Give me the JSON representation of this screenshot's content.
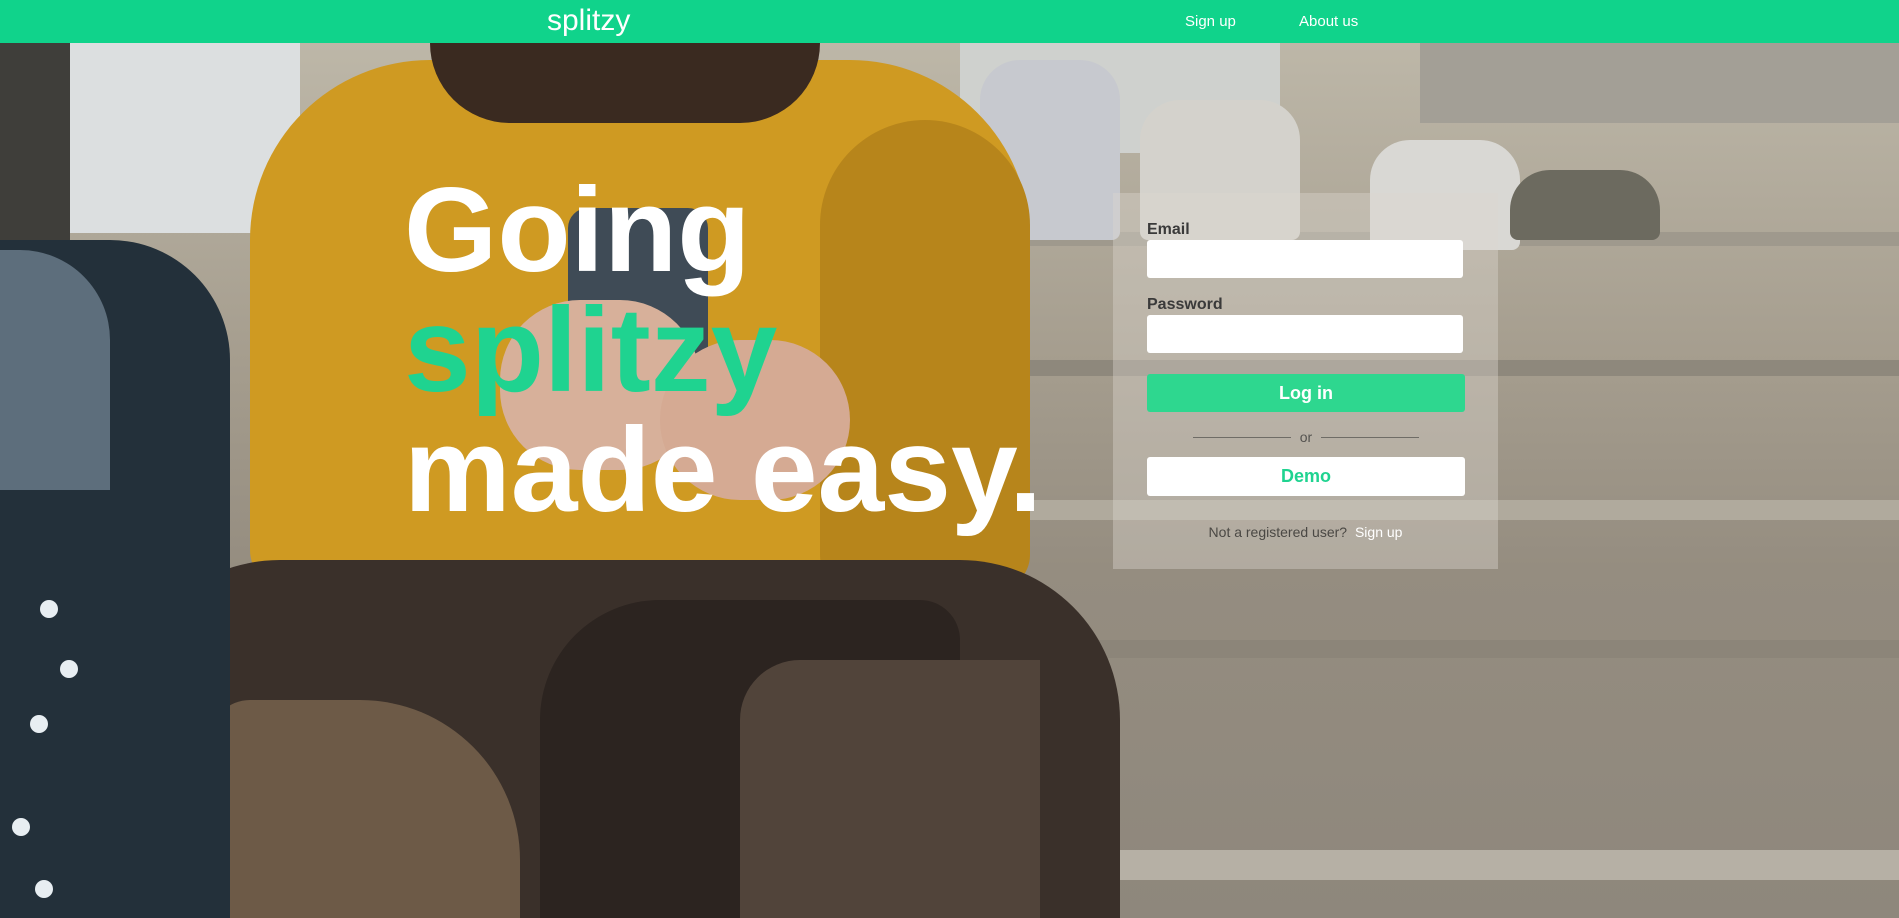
{
  "navbar": {
    "brand": "splitzy",
    "links": [
      {
        "label": "Sign up"
      },
      {
        "label": "About us"
      }
    ],
    "color": "#10d38b"
  },
  "hero": {
    "headline": [
      "Going",
      "splitzy",
      "made easy."
    ],
    "accent_color": "#1fd390"
  },
  "login": {
    "email_label": "Email",
    "email_value": "",
    "password_label": "Password",
    "password_value": "",
    "login_button": "Log in",
    "divider_text": "or",
    "demo_button": "Demo",
    "register_prompt": "Not a registered user?",
    "register_link": "Sign up"
  }
}
